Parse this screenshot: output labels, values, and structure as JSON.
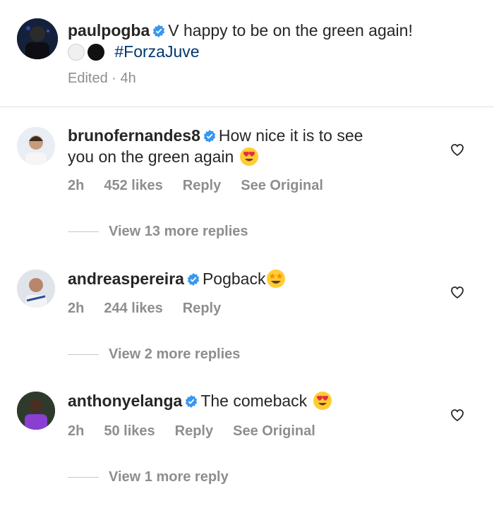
{
  "post": {
    "username": "paulpogba",
    "caption": "V happy to be on the green again!",
    "hashtag": "#ForzaJuve",
    "meta": "Edited · 4h"
  },
  "comments": [
    {
      "username": "brunofernandes8",
      "text_line1": "How nice it is to see",
      "text_line2": "you on the green again",
      "emoji": "heart-eyes",
      "time": "2h",
      "likes": "452 likes",
      "reply": "Reply",
      "see_original": "See Original",
      "view_replies": "View 13 more replies"
    },
    {
      "username": "andreaspereira",
      "text_line1": "Pogback",
      "emoji": "star-struck",
      "time": "2h",
      "likes": "244 likes",
      "reply": "Reply",
      "view_replies": "View 2 more replies"
    },
    {
      "username": "anthonyelanga",
      "text_line1": "The comeback",
      "emoji": "heart-eyes",
      "time": "2h",
      "likes": "50 likes",
      "reply": "Reply",
      "see_original": "See Original",
      "view_replies": "View 1 more reply"
    }
  ],
  "colors": {
    "verified": "#3897f0",
    "meta": "#8e8e8e",
    "hashtag": "#00376b"
  }
}
